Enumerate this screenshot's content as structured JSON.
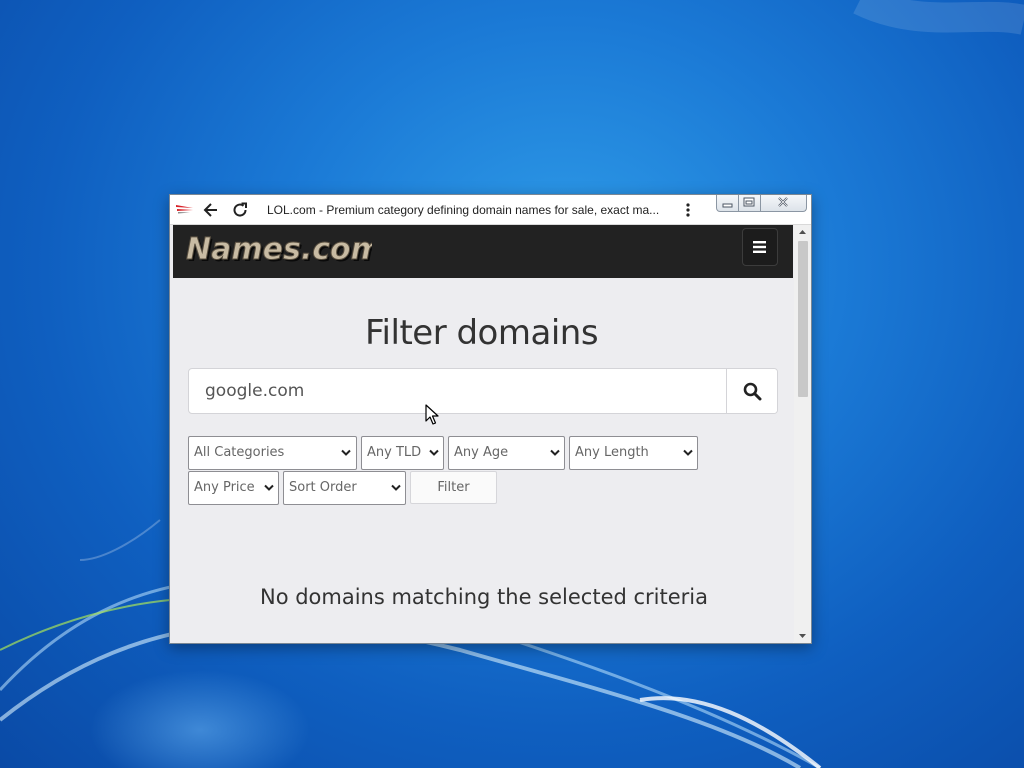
{
  "window": {
    "title": "LOL.com - Premium category defining domain names for sale, exact ma..."
  },
  "site": {
    "logo_text": "Names.com"
  },
  "main": {
    "heading": "Filter domains",
    "search": {
      "value": "google.com"
    },
    "filters": [
      {
        "label": "All Categories"
      },
      {
        "label": "Any TLD"
      },
      {
        "label": "Any Age"
      },
      {
        "label": "Any Length"
      },
      {
        "label": "Any Price"
      },
      {
        "label": "Sort Order"
      }
    ],
    "filter_button": "Filter",
    "empty_message": "No domains matching the selected criteria"
  },
  "icons": {
    "back": "back-arrow-icon",
    "reload": "reload-icon",
    "menu": "more-vertical-icon",
    "hamburger": "hamburger-menu-icon",
    "search": "search-icon",
    "dropdown": "chevron-down-icon"
  },
  "colors": {
    "header_bg": "#222222",
    "page_bg": "#ededf0",
    "desktop_bg": "#1b7ad6",
    "logo_fill": "#c8bba3"
  }
}
